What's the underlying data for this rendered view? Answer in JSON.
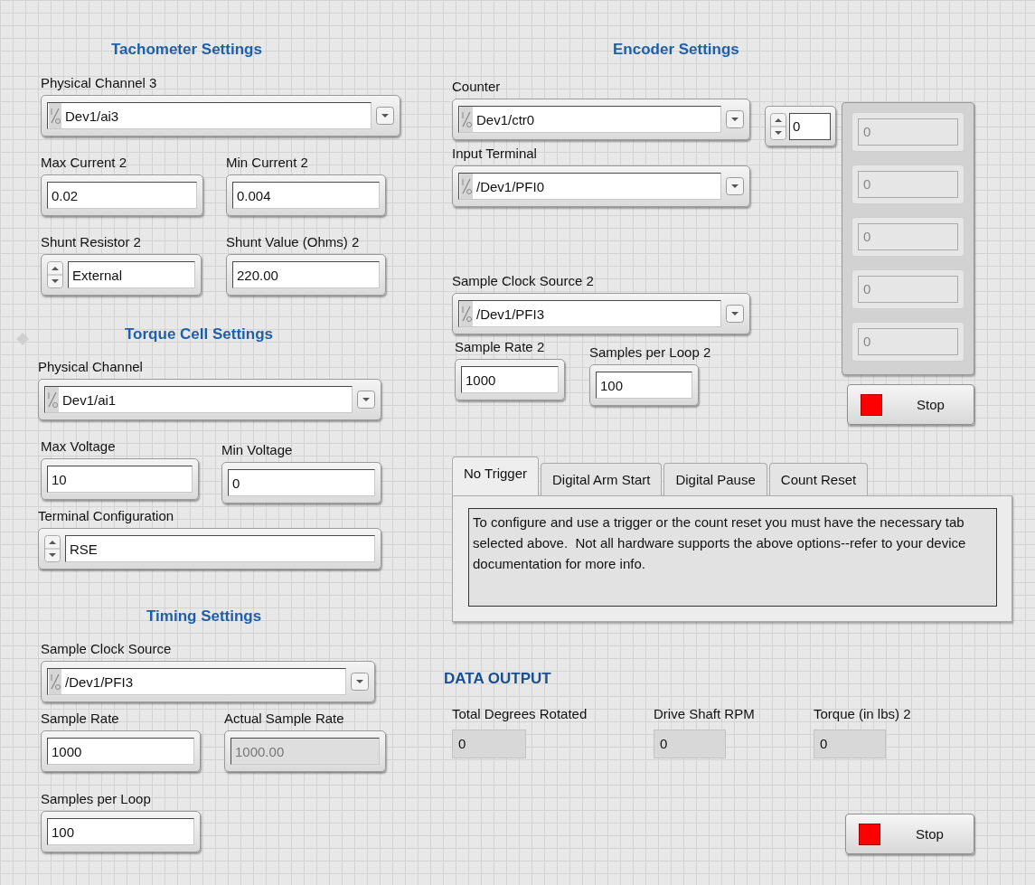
{
  "controls": [
    {
      "kind": "heading",
      "text": "Tachometer Settings"
    },
    {
      "kind": "io",
      "label": "Physical Channel 3",
      "value": "Dev1/ai3"
    },
    {
      "kind": "numeric",
      "label": "Max Current 2",
      "value": "0.02"
    },
    {
      "kind": "numeric",
      "label": "Min Current 2",
      "value": "0.004"
    },
    {
      "kind": "ring",
      "label": "Shunt Resistor 2",
      "value": "External"
    },
    {
      "kind": "numeric",
      "label": "Shunt Value (Ohms) 2",
      "value": "220.00"
    },
    {
      "kind": "heading",
      "text": "Torque Cell Settings"
    },
    {
      "kind": "io",
      "label": "Physical Channel",
      "value": "Dev1/ai1"
    },
    {
      "kind": "numeric",
      "label": "Max Voltage",
      "value": "10"
    },
    {
      "kind": "numeric",
      "label": "Min Voltage",
      "value": "0"
    },
    {
      "kind": "ring",
      "label": "Terminal Configuration",
      "value": "RSE"
    },
    {
      "kind": "heading",
      "text": "Timing Settings"
    },
    {
      "kind": "io",
      "label": "Sample Clock Source",
      "value": "/Dev1/PFI3"
    },
    {
      "kind": "numeric",
      "label": "Sample Rate",
      "value": "1000"
    },
    {
      "kind": "indicator",
      "label": "Actual Sample Rate",
      "value": "1000.00"
    },
    {
      "kind": "numeric",
      "label": "Samples per Loop",
      "value": "100"
    },
    {
      "kind": "heading",
      "text": "Encoder Settings"
    },
    {
      "kind": "io",
      "label": "Counter",
      "value": "Dev1/ctr0"
    },
    {
      "kind": "io",
      "label": "Input Terminal",
      "value": "/Dev1/PFI0"
    },
    {
      "kind": "io",
      "label": "Sample Clock Source 2",
      "value": "/Dev1/PFI3"
    },
    {
      "kind": "numeric",
      "label": "Sample Rate 2",
      "value": "1000"
    },
    {
      "kind": "numeric",
      "label": "Samples per Loop 2",
      "value": "100"
    },
    {
      "kind": "array",
      "index": "0",
      "elements": [
        "0",
        "0",
        "0",
        "0",
        "0"
      ]
    },
    {
      "kind": "button",
      "label": "Stop"
    },
    {
      "kind": "tabs",
      "tabs": [
        {
          "label": "No Trigger",
          "selected": true
        },
        {
          "label": "Digital Arm Start",
          "selected": false
        },
        {
          "label": "Digital Pause",
          "selected": false
        },
        {
          "label": "Count Reset",
          "selected": false
        }
      ],
      "text": "To configure and use a trigger or the count reset you must have the necessary tab selected above.  Not all hardware supports the above options--refer to your device documentation for more info."
    },
    {
      "kind": "section",
      "text": "DATA OUTPUT"
    },
    {
      "kind": "readout",
      "label": "Total Degrees Rotated",
      "value": "0"
    },
    {
      "kind": "readout",
      "label": "Drive Shaft RPM",
      "value": "0"
    },
    {
      "kind": "readout",
      "label": "Torque (in lbs) 2",
      "value": "0"
    },
    {
      "kind": "button",
      "label": "Stop"
    }
  ]
}
